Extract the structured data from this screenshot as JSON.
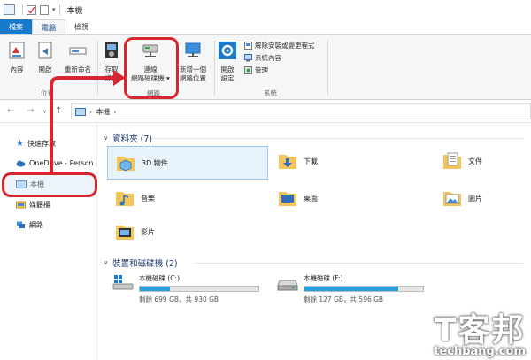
{
  "titlebar": {
    "title": "本機"
  },
  "ribbon_tabs": [
    "檔案",
    "電腦",
    "檢視"
  ],
  "ribbon": {
    "location_group": {
      "label": "位置",
      "properties": "內容",
      "open": "開啟",
      "rename": "重新命名"
    },
    "network_group": {
      "label": "網路",
      "access_media": "存取\n媒體",
      "map_drive_line1": "連線",
      "map_drive_line2": "網路磁碟機 ▾",
      "add_location_line1": "新增一個",
      "add_location_line2": "網路位置"
    },
    "system_group": {
      "label": "系統",
      "open_settings_line1": "開啟",
      "open_settings_line2": "設定",
      "uninstall": "解除安裝或變更程式",
      "system_properties": "系統內容",
      "manage": "管理"
    }
  },
  "address": {
    "path": "本機",
    "separator": "›"
  },
  "sidebar": {
    "quick_access": "快速存取",
    "onedrive": "OneDrive - Person",
    "this_pc": "本機",
    "libraries": "媒體櫃",
    "network": "網路"
  },
  "folders_section": {
    "title": "資料夾 (7)"
  },
  "folders": [
    {
      "label": "3D 物件"
    },
    {
      "label": "下載"
    },
    {
      "label": "文件"
    },
    {
      "label": "音樂"
    },
    {
      "label": "桌面"
    },
    {
      "label": "圖片"
    },
    {
      "label": "影片"
    }
  ],
  "drives_section": {
    "title": "裝置和磁碟機 (2)"
  },
  "drives": [
    {
      "name": "本機磁碟 (C:)",
      "free": "剩餘 699 GB，共 930 GB",
      "used_fraction": 0.25
    },
    {
      "name": "本機磁碟 (F:)",
      "free": "剩餘 127 GB，共 596 GB",
      "used_fraction": 0.79
    }
  ],
  "watermark": {
    "big": "T客邦",
    "small": "techbang.com"
  },
  "colors": {
    "accent": "#1979ca",
    "highlight": "#d8262f",
    "drive_bar": "#26a0da",
    "folder": "#f2c65a"
  }
}
